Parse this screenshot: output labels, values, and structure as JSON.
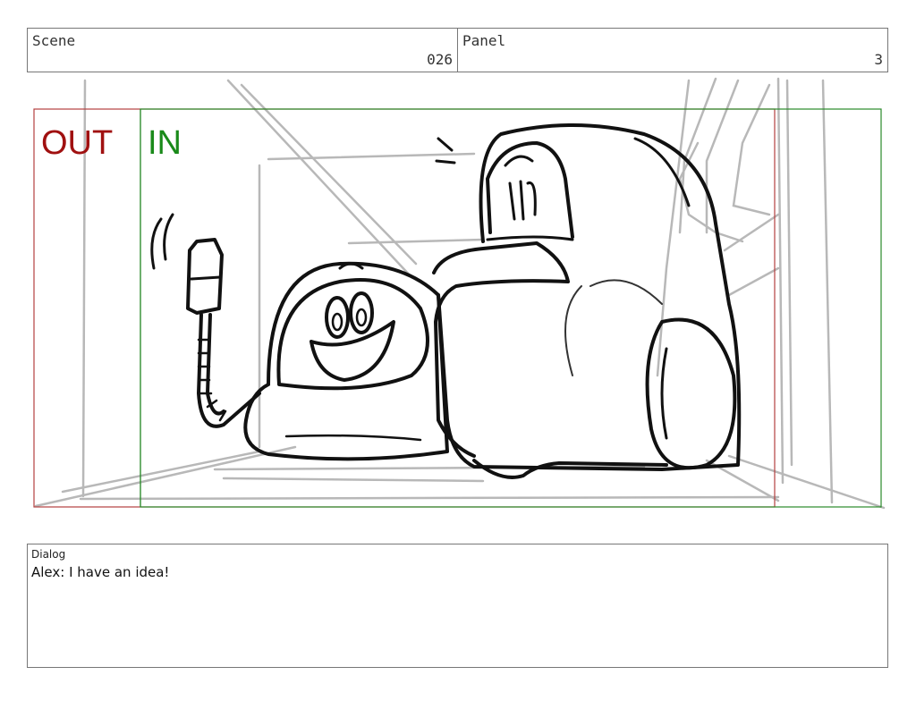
{
  "header": {
    "scene_label": "Scene",
    "scene_value": "026",
    "panel_label": "Panel",
    "panel_value": "3"
  },
  "frame": {
    "out_label": "OUT",
    "in_label": "IN",
    "out_color": "#a01010",
    "in_color": "#1a8a1a"
  },
  "dialog": {
    "label": "Dialog",
    "text": "Alex: I have an idea!"
  }
}
